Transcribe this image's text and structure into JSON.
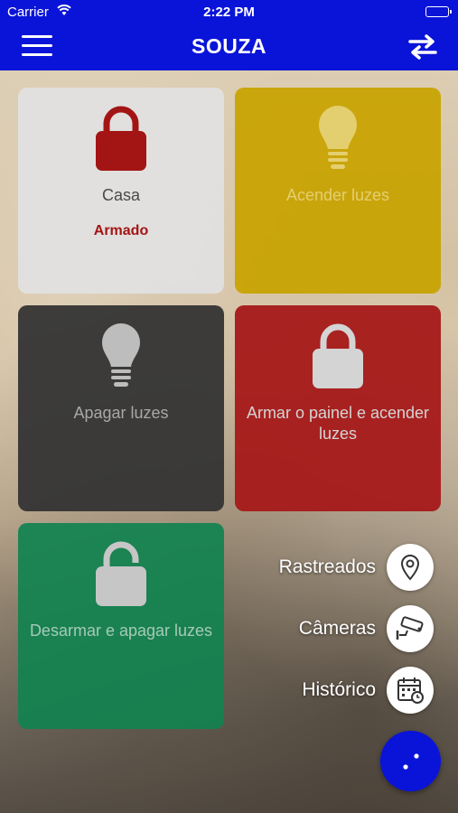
{
  "status_bar": {
    "carrier": "Carrier",
    "time": "2:22 PM"
  },
  "navbar": {
    "title": "SOUZA",
    "menu_icon": "hamburger-menu-icon",
    "swap_icon": "swap-arrows-icon"
  },
  "tiles": [
    {
      "label": "Casa",
      "sublabel": "Armado",
      "icon": "lock-closed-icon",
      "color": "#e1e1e1"
    },
    {
      "label": "Acender luzes",
      "icon": "lightbulb-icon",
      "color": "#c8a300"
    },
    {
      "label": "Apagar luzes",
      "icon": "lightbulb-icon",
      "color": "#343434"
    },
    {
      "label": "Armar o painel e acender luzes",
      "icon": "lock-closed-icon",
      "color": "#a51919"
    },
    {
      "label": "Desarmar e apagar luzes",
      "icon": "lock-open-icon",
      "color": "#128250"
    }
  ],
  "fab_menu": [
    {
      "label": "Rastreados",
      "icon": "map-pin-icon"
    },
    {
      "label": "Câmeras",
      "icon": "security-camera-icon"
    },
    {
      "label": "Histórico",
      "icon": "calendar-icon"
    }
  ],
  "accent_color": "#0a14d8"
}
